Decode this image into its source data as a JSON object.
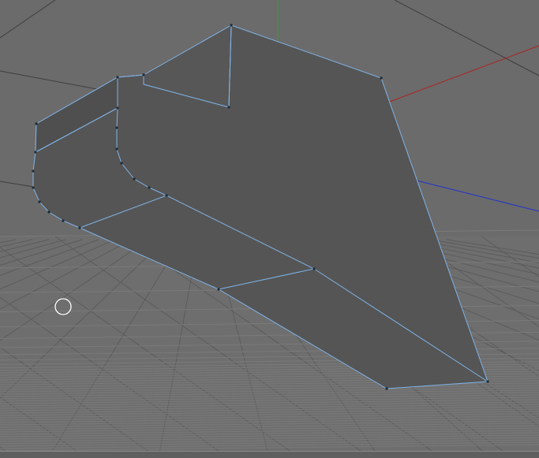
{
  "viewport": {
    "name": "3d-viewport",
    "background_color": "#6e6e6e",
    "grid_color": "#5c5c5c",
    "horizon_grid_color": "#7a7a7a"
  },
  "axes": {
    "x_color": "#b01f1f",
    "y_color": "#2fa02f",
    "z_color": "#2233cc"
  },
  "mesh": {
    "face_color": "#555555",
    "edge_color": "#7fb2e6",
    "vertex_color": "#1e2a36"
  },
  "cursor": {
    "icon": "circle-cursor-icon"
  }
}
